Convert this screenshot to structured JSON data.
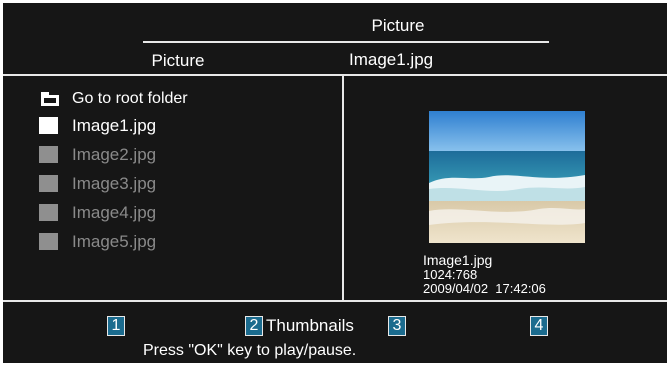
{
  "title": "Picture",
  "header": {
    "left": "Picture",
    "right": "Image1.jpg"
  },
  "file_list": {
    "root_label": "Go to root folder",
    "items": [
      {
        "label": "Image1.jpg",
        "state": "active"
      },
      {
        "label": "Image2.jpg",
        "state": "dim"
      },
      {
        "label": "Image3.jpg",
        "state": "dim"
      },
      {
        "label": "Image4.jpg",
        "state": "dim"
      },
      {
        "label": "Image5.jpg",
        "state": "dim"
      }
    ]
  },
  "preview": {
    "name": "Image1.jpg",
    "resolution": "1024:768",
    "datetime": "2009/04/02  17:42:06"
  },
  "keys": [
    {
      "num": "1",
      "label": ""
    },
    {
      "num": "2",
      "label": "Thumbnails"
    },
    {
      "num": "3",
      "label": ""
    },
    {
      "num": "4",
      "label": ""
    }
  ],
  "help_text": "Press \"OK\" key to play/pause.",
  "colors": {
    "background": "#161616",
    "text": "#ffffff",
    "dim_text": "#8a8a8a",
    "key_blue": "#1b6b8e",
    "line": "#e8e8e8"
  }
}
